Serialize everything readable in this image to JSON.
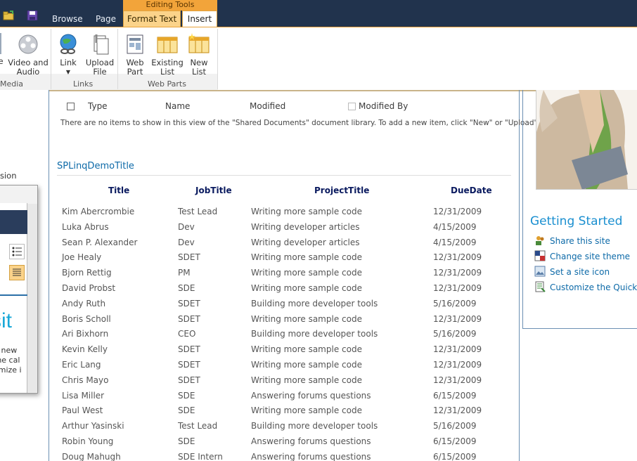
{
  "tabs": {
    "browse": "Browse",
    "page": "Page",
    "editing_tools": "Editing Tools",
    "format_text": "Format Text",
    "insert": "Insert"
  },
  "ribbon": {
    "partial_btn": "e",
    "video_line1": "Video and",
    "video_line2": "Audio",
    "link": "Link",
    "upload_line1": "Upload",
    "upload_line2": "File",
    "webpart_line1": "Web",
    "webpart_line2": "Part",
    "existing_line1": "Existing",
    "existing_line2": "List",
    "new_line1": "New",
    "new_line2": "List",
    "group_media": "Media",
    "group_links": "Links",
    "group_webparts": "Web Parts"
  },
  "doclib": {
    "cols": {
      "type": "Type",
      "name": "Name",
      "modified": "Modified",
      "modified_by": "Modified By"
    },
    "empty_message": "There are no items to show in this view of the \"Shared Documents\" document library. To add a new item, click \"New\" or \"Upload\"."
  },
  "webpart": {
    "title": "SPLinqDemoTitle",
    "columns": [
      "Title",
      "JobTitle",
      "ProjectTitle",
      "DueDate"
    ],
    "rows": [
      [
        "Kim Abercrombie",
        "Test Lead",
        "Writing more sample code",
        "12/31/2009"
      ],
      [
        "Luka Abrus",
        "Dev",
        "Writing developer articles",
        "4/15/2009"
      ],
      [
        "Sean P. Alexander",
        "Dev",
        "Writing developer articles",
        "4/15/2009"
      ],
      [
        "Joe Healy",
        "SDET",
        "Writing more sample code",
        "12/31/2009"
      ],
      [
        "Bjorn Rettig",
        "PM",
        "Writing more sample code",
        "12/31/2009"
      ],
      [
        "David Probst",
        "SDE",
        "Writing more sample code",
        "12/31/2009"
      ],
      [
        "Andy Ruth",
        "SDET",
        "Building more developer tools",
        "5/16/2009"
      ],
      [
        "Boris Scholl",
        "SDET",
        "Writing more sample code",
        "12/31/2009"
      ],
      [
        "Ari Bixhorn",
        "CEO",
        "Building more developer tools",
        "5/16/2009"
      ],
      [
        "Kevin Kelly",
        "SDET",
        "Writing more sample code",
        "12/31/2009"
      ],
      [
        "Eric Lang",
        "SDET",
        "Writing more sample code",
        "12/31/2009"
      ],
      [
        "Chris Mayo",
        "SDET",
        "Writing more sample code",
        "12/31/2009"
      ],
      [
        "Lisa Miller",
        "SDE",
        "Answering forums questions",
        "6/15/2009"
      ],
      [
        "Paul West",
        "SDE",
        "Writing more sample code",
        "12/31/2009"
      ],
      [
        "Arthur Yasinski",
        "Test Lead",
        "Building more developer tools",
        "5/16/2009"
      ],
      [
        "Robin Young",
        "SDE",
        "Answering forums questions",
        "6/15/2009"
      ],
      [
        "Doug Mahugh",
        "SDE Intern",
        "Answering forums questions",
        "6/15/2009"
      ]
    ]
  },
  "left": {
    "partial_text": "sion",
    "dialog_big": "sit",
    "dialog_line1": "d new",
    "dialog_line2": "the cal",
    "dialog_line3": "omize i"
  },
  "getting_started": {
    "title": "Getting Started",
    "items": [
      "Share this site",
      "Change site theme",
      "Set a site icon",
      "Customize the Quick L"
    ]
  },
  "colors": {
    "topbar": "#21334d",
    "accent_orange": "#f2a43a",
    "link_blue": "#0d6aa8",
    "header_navy": "#0a1a5f"
  }
}
